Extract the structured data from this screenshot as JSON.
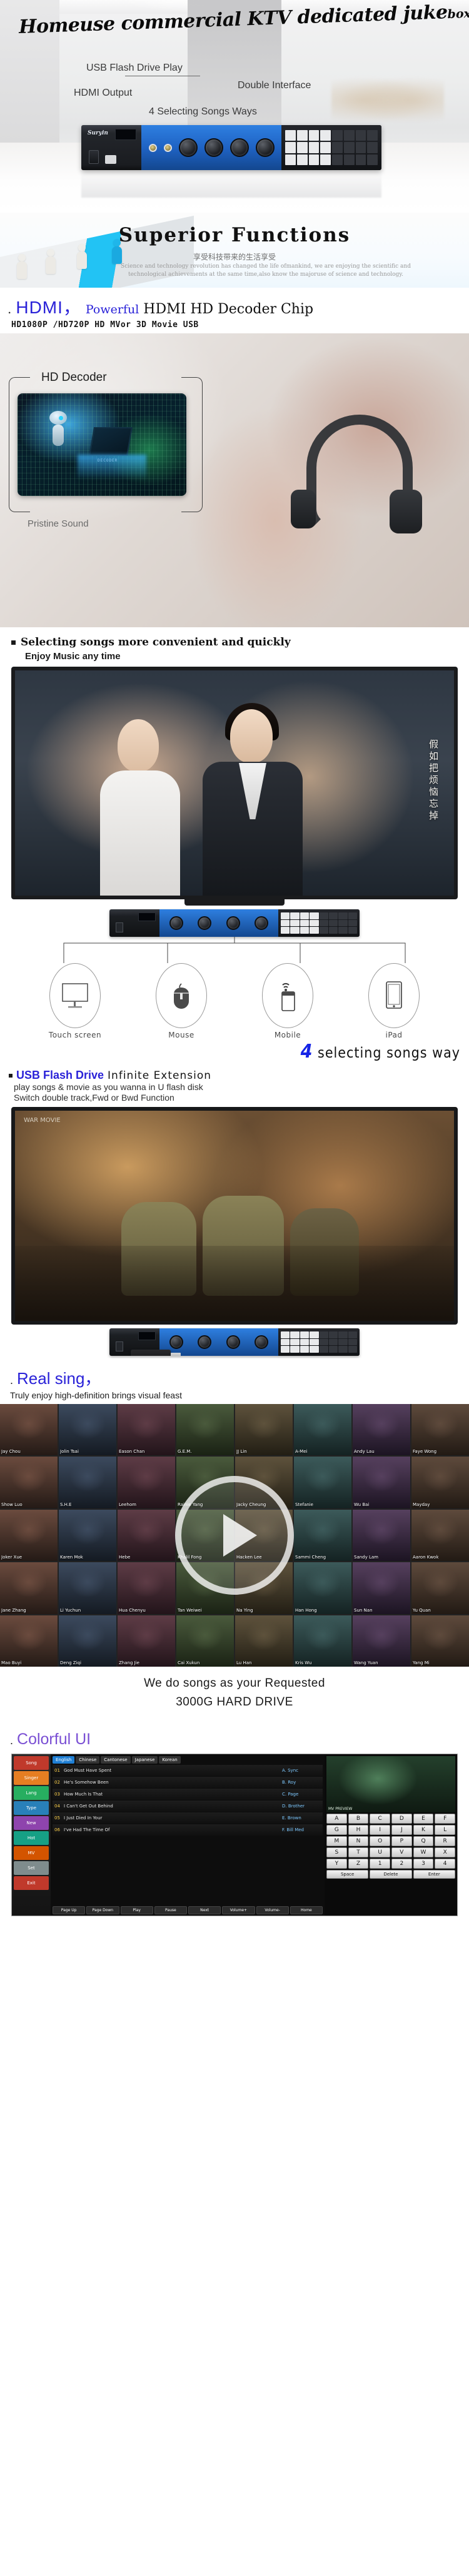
{
  "hero": {
    "title_main": "Homeuse commercial KTV dedicated juke",
    "title_tail": "box",
    "features": {
      "usb": "USB Flash Drive Play",
      "hdmi": "HDMI Output",
      "double": "Double Interface",
      "ways": "4 Selecting Songs Ways"
    },
    "device_brand": "Suryin"
  },
  "superior": {
    "title": "Superior Functions",
    "subtitle_cn": "享受科技带来的生活享受",
    "paragraph": "Science and technology revolution has changed the life ofmankind, we are enjoying the scientific and technological achievements at the same time,also know the majoruse of science and technology."
  },
  "hdmi": {
    "dot": ".",
    "brand": "HDMI，",
    "powerful": "Powerful",
    "rest": " HDMI HD Decoder Chip",
    "specs": "HD1080P /HD720P HD MVor 3D Movie USB",
    "decoder_label": "HD Decoder",
    "sound_label": "Pristine Sound",
    "chip_text": "DECODER"
  },
  "selecting": {
    "title": "Selecting songs more convenient and quickly",
    "subtitle": "Enjoy Music any time",
    "tv_lyric": "假如把烦恼忘掉",
    "four_ways_num": "4",
    "four_ways_text": "selecting songs way",
    "icons": [
      {
        "name": "touch-screen",
        "label": "Touch screen"
      },
      {
        "name": "mouse",
        "label": "Mouse"
      },
      {
        "name": "mobile",
        "label": "Mobile"
      },
      {
        "name": "ipad",
        "label": "iPad"
      }
    ]
  },
  "usb_section": {
    "blue": "USB Flash Drive",
    "black": "Infinite Extension",
    "line1": "play songs & movie as you wanna in U flash disk",
    "line2": "Switch double track,Fwd or Bwd Function",
    "scene_caption": "WAR MOVIE"
  },
  "real_sing": {
    "dot": ".",
    "title": "Real sing，",
    "subtitle": "Truly enjoy high-definition brings visual feast",
    "requested": "We do songs as your Requested",
    "hard_drive": "3000G HARD DRIVE",
    "celebs": [
      "Jay Chou",
      "Jolin Tsai",
      "Eason Chan",
      "G.E.M.",
      "JJ Lin",
      "A-Mei",
      "Andy Lau",
      "Faye Wong",
      "Show Luo",
      "S.H.E",
      "Leehom",
      "Rainie Yang",
      "Jacky Cheung",
      "Stefanie",
      "Wu Bai",
      "Mayday",
      "Joker Xue",
      "Karen Mok",
      "Hebe",
      "Khalil Fong",
      "Hacken Lee",
      "Sammi Cheng",
      "Sandy Lam",
      "Aaron Kwok",
      "Jane Zhang",
      "Li Yuchun",
      "Hua Chenyu",
      "Tan Weiwei",
      "Na Ying",
      "Han Hong",
      "Sun Nan",
      "Yu Quan",
      "Mao Buyi",
      "Deng Ziqi",
      "Zhang Jie",
      "Cai Xukun",
      "Lu Han",
      "Kris Wu",
      "Wang Yuan",
      "Yang Mi"
    ]
  },
  "colorful_ui": {
    "dot": ".",
    "title": "Colorful UI",
    "left_buttons": [
      {
        "label": "Song",
        "color": "#c0392b"
      },
      {
        "label": "Singer",
        "color": "#e67e22"
      },
      {
        "label": "Lang",
        "color": "#27ae60"
      },
      {
        "label": "Type",
        "color": "#2980b9"
      },
      {
        "label": "New",
        "color": "#8e44ad"
      },
      {
        "label": "Hot",
        "color": "#16a085"
      },
      {
        "label": "MV",
        "color": "#d35400"
      },
      {
        "label": "Set",
        "color": "#7f8c8d"
      },
      {
        "label": "Exit",
        "color": "#c0392b"
      }
    ],
    "tabs": [
      {
        "label": "English",
        "active": true
      },
      {
        "label": "Chinese",
        "active": false
      },
      {
        "label": "Cantonese",
        "active": false
      },
      {
        "label": "Japanese",
        "active": false
      },
      {
        "label": "Korean",
        "active": false
      }
    ],
    "songs": [
      {
        "idx": "01",
        "title": "God Must Have Spent",
        "artist": "A. Sync"
      },
      {
        "idx": "02",
        "title": "He's Somehow Been",
        "artist": "B. Roy"
      },
      {
        "idx": "03",
        "title": "How Much Is That",
        "artist": "C. Page"
      },
      {
        "idx": "04",
        "title": "I Can't Get Out Behind",
        "artist": "D. Brother"
      },
      {
        "idx": "05",
        "title": "I Just Died In Your",
        "artist": "E. Brown"
      },
      {
        "idx": "06",
        "title": "I've Had The Time Of",
        "artist": "F. Bill Med"
      }
    ],
    "video_caption": "MV PREVIEW",
    "keys": [
      "A",
      "B",
      "C",
      "D",
      "E",
      "F",
      "G",
      "H",
      "I",
      "J",
      "K",
      "L",
      "M",
      "N",
      "O",
      "P",
      "Q",
      "R",
      "S",
      "T",
      "U",
      "V",
      "W",
      "X",
      "Y",
      "Z",
      "1",
      "2",
      "3",
      "4"
    ],
    "wide_keys": [
      "Space",
      "Delete",
      "Enter"
    ],
    "bottom_buttons": [
      "Page Up",
      "Page Down",
      "Play",
      "Pause",
      "Next",
      "Volume+",
      "Volume-",
      "Home"
    ]
  }
}
